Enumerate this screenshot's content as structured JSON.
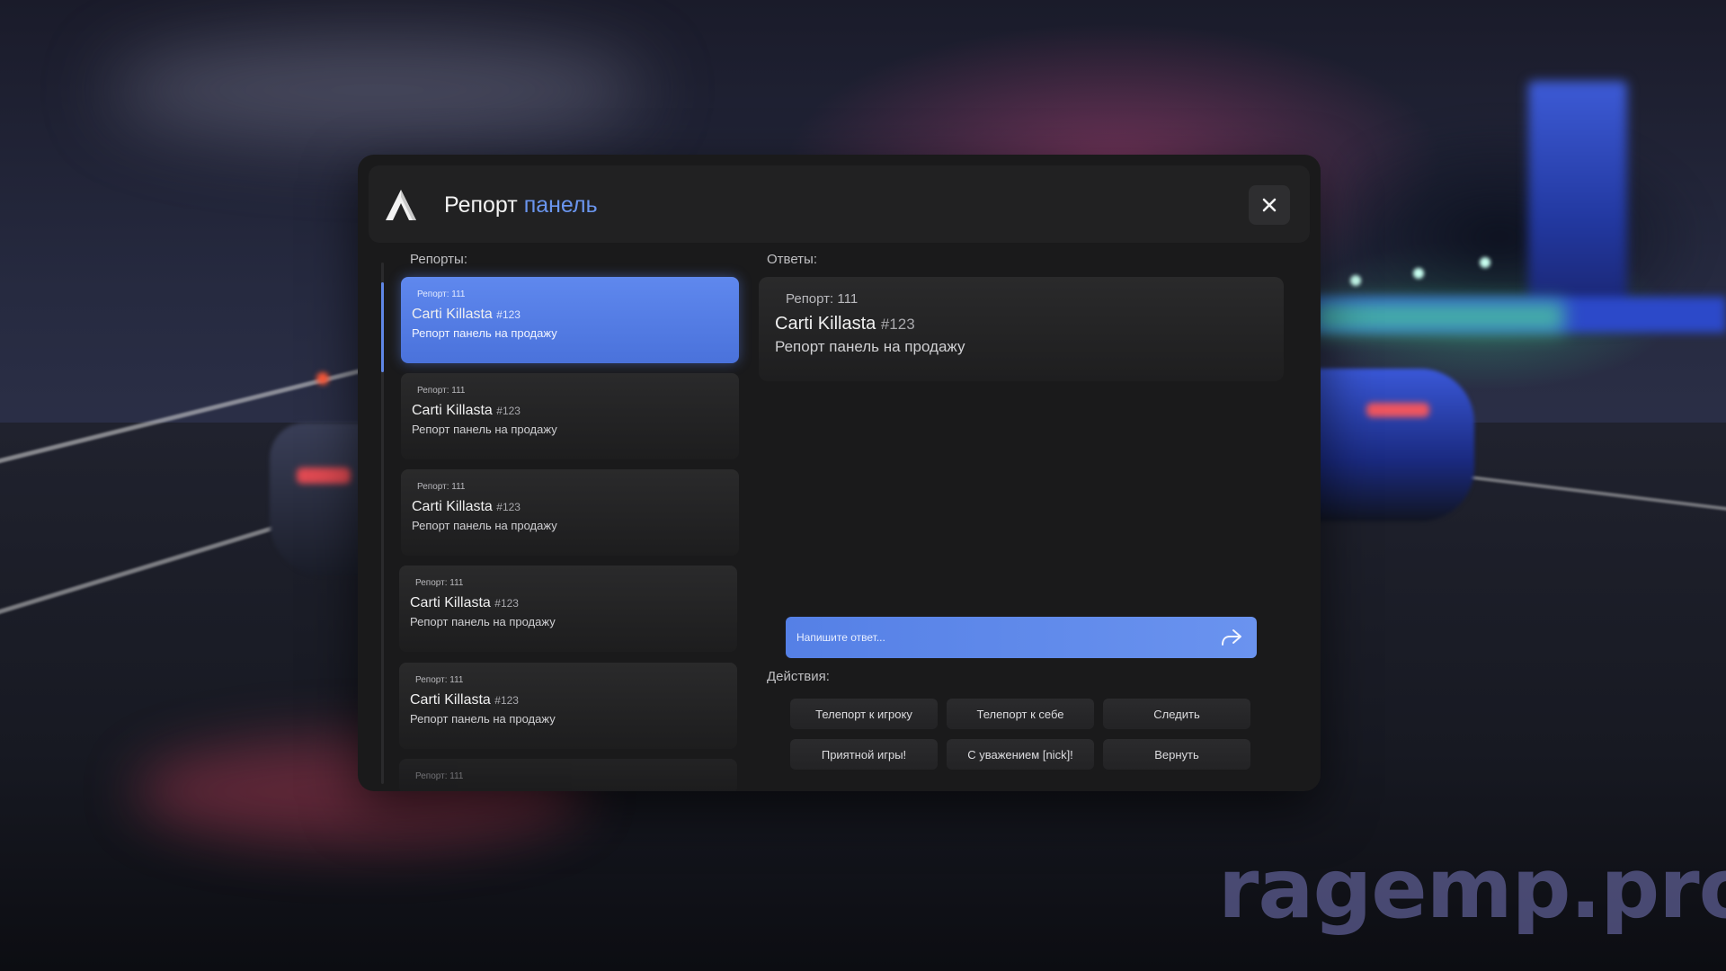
{
  "header": {
    "title_main": "Репорт",
    "title_accent": "панель",
    "logo_icon": "triangle-a-logo-icon",
    "close_icon": "close-icon"
  },
  "reports_section": {
    "label": "Репорты:",
    "items": [
      {
        "number": "Репорт: 111",
        "name": "Carti Killasta",
        "tag": "#123",
        "desc": "Репорт панель на продажу",
        "active": true
      },
      {
        "number": "Репорт: 111",
        "name": "Carti Killasta",
        "tag": "#123",
        "desc": "Репорт панель на продажу",
        "active": false
      },
      {
        "number": "Репорт: 111",
        "name": "Carti Killasta",
        "tag": "#123",
        "desc": "Репорт панель на продажу",
        "active": false
      },
      {
        "number": "Репорт: 111",
        "name": "Carti Killasta",
        "tag": "#123",
        "desc": "Репорт панель на продажу",
        "active": false
      },
      {
        "number": "Репорт: 111",
        "name": "Carti Killasta",
        "tag": "#123",
        "desc": "Репорт панель на продажу",
        "active": false
      },
      {
        "number": "Репорт: 111"
      }
    ]
  },
  "answers_section": {
    "label": "Ответы:",
    "card": {
      "number": "Репорт: 111",
      "name": "Carti Killasta",
      "tag": "#123",
      "desc": "Репорт панель на продажу"
    }
  },
  "reply": {
    "placeholder": "Напишите ответ...",
    "send_icon": "send-arrow-icon"
  },
  "actions": {
    "label": "Действия:",
    "buttons": [
      "Телепорт к игроку",
      "Телепорт к себе",
      "Следить",
      "Приятной игры!",
      "С уважением [nick]!",
      "Вернуть"
    ]
  },
  "watermark": "ragemp.pro",
  "colors": {
    "accent": "#6a95ee",
    "panel_bg": "#1a1a1b",
    "active_card": "#5f88ee"
  }
}
